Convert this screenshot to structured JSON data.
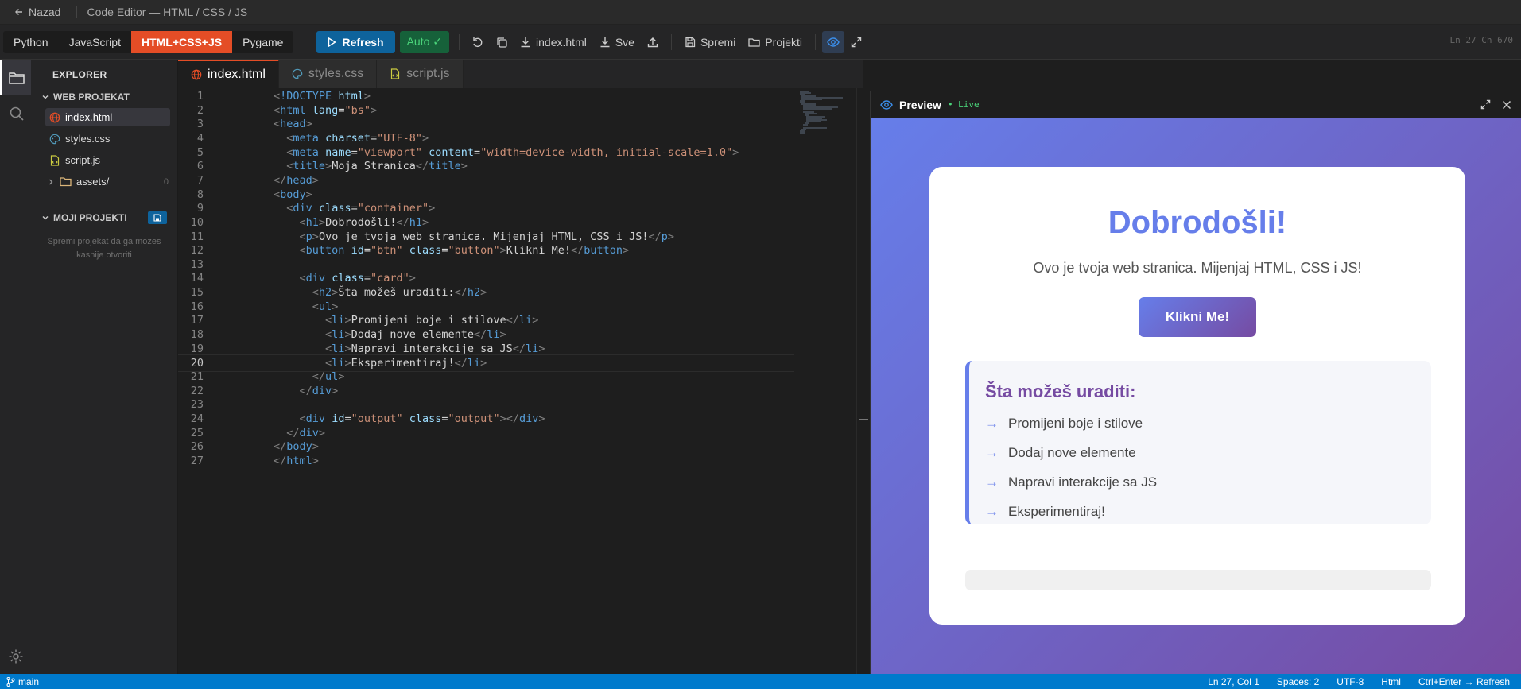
{
  "topbar": {
    "back_label": "Nazad",
    "title": "Code Editor — HTML / CSS / JS"
  },
  "toolbar": {
    "languages": [
      "Python",
      "JavaScript",
      "HTML+CSS+JS",
      "Pygame"
    ],
    "active_language": "HTML+CSS+JS",
    "refresh_label": "Refresh",
    "auto_label": "Auto ✓",
    "download_file_label": "index.html",
    "download_all_label": "Sve",
    "save_label": "Spremi",
    "projects_label": "Projekti",
    "position_label": "Ln 27  Ch 670"
  },
  "explorer": {
    "title": "EXPLORER",
    "section": "WEB PROJEKAT",
    "files": [
      "index.html",
      "styles.css",
      "script.js"
    ],
    "folder": {
      "name": "assets/",
      "count": "0"
    },
    "projects_section": "MOJI PROJEKTI",
    "projects_hint": "Spremi projekat da ga mozes kasnije otvoriti"
  },
  "tabs": [
    {
      "label": "index.html",
      "icon": "globe-icon",
      "color": "#e44d26"
    },
    {
      "label": "styles.css",
      "icon": "palette-icon",
      "color": "#519aba"
    },
    {
      "label": "script.js",
      "icon": "js-file-icon",
      "color": "#cbcb41"
    }
  ],
  "editor": {
    "current_line": 20,
    "lines": [
      "<!DOCTYPE html>",
      "<html lang=\"bs\">",
      "<head>",
      "  <meta charset=\"UTF-8\">",
      "  <meta name=\"viewport\" content=\"width=device-width, initial-scale=1.0\">",
      "  <title>Moja Stranica</title>",
      "</head>",
      "<body>",
      "  <div class=\"container\">",
      "    <h1>Dobrodošli!</h1>",
      "    <p>Ovo je tvoja web stranica. Mijenjaj HTML, CSS i JS!</p>",
      "    <button id=\"btn\" class=\"button\">Klikni Me!</button>",
      "",
      "    <div class=\"card\">",
      "      <h2>Šta možeš uraditi:</h2>",
      "      <ul>",
      "        <li>Promijeni boje i stilove</li>",
      "        <li>Dodaj nove elemente</li>",
      "        <li>Napravi interakcije sa JS</li>",
      "        <li>Eksperimentiraj!</li>",
      "      </ul>",
      "    </div>",
      "",
      "    <div id=\"output\" class=\"output\"></div>",
      "  </div>",
      "</body>",
      "</html>"
    ]
  },
  "preview": {
    "title": "Preview",
    "live_label": "• Live",
    "heading": "Dobrodošli!",
    "text": "Ovo je tvoja web stranica. Mijenjaj HTML, CSS i JS!",
    "button": "Klikni Me!",
    "card_heading": "Šta možeš uraditi:",
    "items": [
      "Promijeni boje i stilove",
      "Dodaj nove elemente",
      "Napravi interakcije sa JS",
      "Eksperimentiraj!"
    ],
    "arrow": "→"
  },
  "statusbar": {
    "branch": "main",
    "cursor": "Ln 27, Col 1",
    "spaces": "Spaces: 2",
    "encoding": "UTF-8",
    "language": "Html",
    "shortcut": "Ctrl+Enter → Refresh"
  },
  "colors": {
    "accent": "#007acc",
    "html": "#e44d26",
    "gradient_start": "#667eea",
    "gradient_end": "#764ba2"
  }
}
